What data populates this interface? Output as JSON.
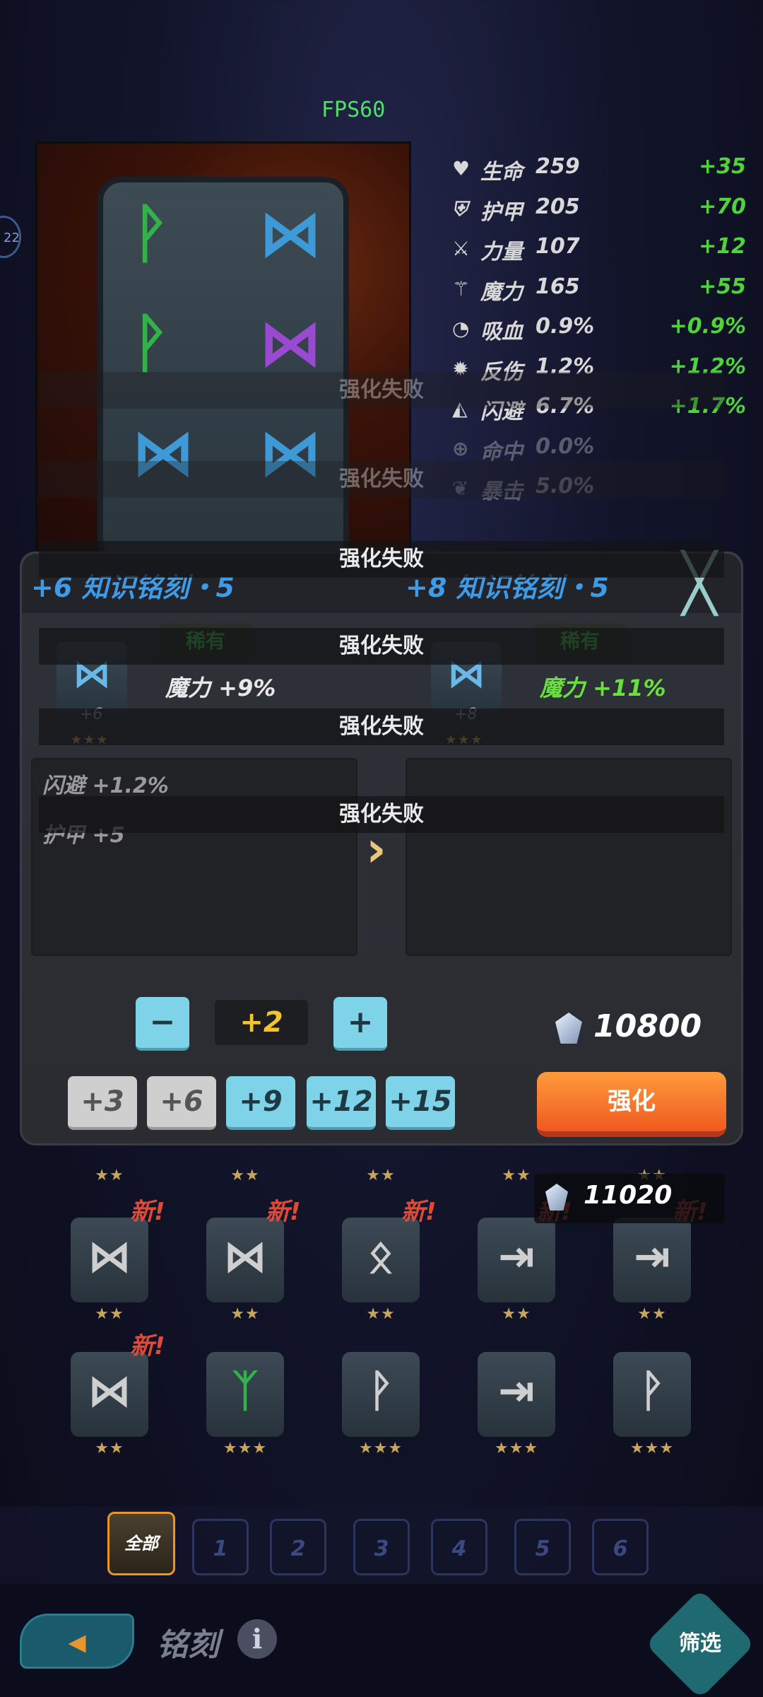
{
  "fps": "FPS60",
  "side_indicator": "22",
  "board": {
    "runes": [
      {
        "glyph": "ᚹ",
        "color": "#33b24a"
      },
      {
        "glyph": "⋈",
        "color": "#3e9ad6"
      },
      {
        "glyph": "ᚹ",
        "color": "#33b24a"
      },
      {
        "glyph": "⋈",
        "color": "#9a4ad0"
      },
      {
        "glyph": "⋈",
        "color": "#3e9ad6"
      },
      {
        "glyph": "⋈",
        "color": "#3e9ad6"
      }
    ]
  },
  "stats": [
    {
      "icon": "heart-icon",
      "glyph": "♥",
      "name": "生命",
      "value": "259",
      "bonus": "+35",
      "dim": false
    },
    {
      "icon": "shield-icon",
      "glyph": "⛨",
      "name": "护甲",
      "value": "205",
      "bonus": "+70",
      "dim": false
    },
    {
      "icon": "sword-icon",
      "glyph": "⚔",
      "name": "力量",
      "value": "107",
      "bonus": "+12",
      "dim": false
    },
    {
      "icon": "wand-icon",
      "glyph": "⚚",
      "name": "魔力",
      "value": "165",
      "bonus": "+55",
      "dim": false
    },
    {
      "icon": "lifesteal-icon",
      "glyph": "◔",
      "name": "吸血",
      "value": "0.9%",
      "bonus": "+0.9%",
      "dim": false
    },
    {
      "icon": "reflect-icon",
      "glyph": "✹",
      "name": "反伤",
      "value": "1.2%",
      "bonus": "+1.2%",
      "dim": false
    },
    {
      "icon": "dodge-icon",
      "glyph": "◭",
      "name": "闪避",
      "value": "6.7%",
      "bonus": "+1.7%",
      "dim": false
    },
    {
      "icon": "crosshair-icon",
      "glyph": "⊕",
      "name": "命中",
      "value": "0.0%",
      "bonus": "",
      "dim": true
    },
    {
      "icon": "crit-icon",
      "glyph": "❦",
      "name": "暴击",
      "value": "5.0%",
      "bonus": "",
      "dim": true
    }
  ],
  "toasts": [
    "强化失败",
    "强化失败",
    "强化失败",
    "强化失败",
    "强化失败",
    "强化失败"
  ],
  "modal": {
    "left": {
      "title": "+6 知识铭刻・5",
      "rarity": "稀有",
      "piece_glyph": "⋈",
      "piece_plus": "+6",
      "stars": "★★★",
      "main_stat": "魔力 +9%",
      "sub_stats": [
        "闪避 +1.2%",
        "护甲 +5"
      ]
    },
    "right": {
      "title": "+8 知识铭刻・5",
      "rarity": "稀有",
      "piece_glyph": "⋈",
      "piece_plus": "+8",
      "stars": "★★★",
      "main_stat": "魔力 +11%"
    },
    "close_glyph": "╳",
    "minus": "−",
    "level": "+2",
    "plus": "+",
    "quick_buttons": [
      "+3",
      "+6",
      "+9",
      "+12",
      "+15"
    ],
    "cost": "10800",
    "strengthen": "强化"
  },
  "balance": "11020",
  "grid": {
    "new_label": "新!",
    "row1": [
      {
        "glyph": "⋈",
        "stars": "★★",
        "new": true
      },
      {
        "glyph": "⋈",
        "stars": "★★",
        "new": true
      },
      {
        "glyph": "ᛟ",
        "stars": "★★",
        "new": true
      },
      {
        "glyph": "⇥",
        "stars": "★★",
        "new": true
      },
      {
        "glyph": "⇥",
        "stars": "★★",
        "new": true
      }
    ],
    "row2": [
      {
        "glyph": "⋈",
        "stars": "★★",
        "new": true,
        "color": "#cfcfcf"
      },
      {
        "glyph": "ᛉ",
        "stars": "★★★",
        "new": false,
        "color": "#33b24a"
      },
      {
        "glyph": "ᚹ",
        "stars": "★★★",
        "new": false,
        "color": "#cfcfcf"
      },
      {
        "glyph": "⇥",
        "stars": "★★★",
        "new": false,
        "color": "#cfcfcf"
      },
      {
        "glyph": "ᚹ",
        "stars": "★★★",
        "new": false,
        "color": "#cfcfcf"
      }
    ],
    "top_stars": [
      "★★",
      "★★",
      "★★",
      "★★",
      "★★"
    ]
  },
  "tabs": [
    "全部",
    "1",
    "2",
    "3",
    "4",
    "5",
    "6"
  ],
  "bottom": {
    "back_glyph": "◂",
    "label": "铭刻",
    "info": "i",
    "filter": "筛选"
  }
}
